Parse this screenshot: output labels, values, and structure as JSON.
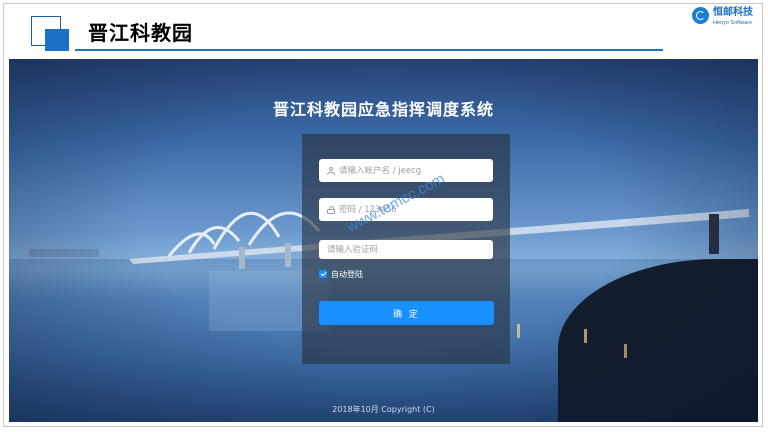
{
  "header": {
    "title": "晋江科教园",
    "logo": {
      "name_cn": "恒邮科技",
      "name_en": "Henyo Software",
      "icon": "company-logo-icon"
    },
    "accent_color": "#1b6fc4"
  },
  "login": {
    "system_title": "晋江科教园应急指挥调度系统",
    "username": {
      "placeholder": "请输入帐户名 / jeecg",
      "icon": "user-icon"
    },
    "password": {
      "placeholder": "密码 / 123456",
      "icon": "lock-icon"
    },
    "captcha": {
      "placeholder": "请输入验证码"
    },
    "remember_label": "自动登陆",
    "remember_checked": true,
    "submit_label": "确 定",
    "button_color": "#1890ff"
  },
  "watermark": "www.temcc.com",
  "footer": {
    "copyright": "2018年10月 Copyright (C)"
  }
}
